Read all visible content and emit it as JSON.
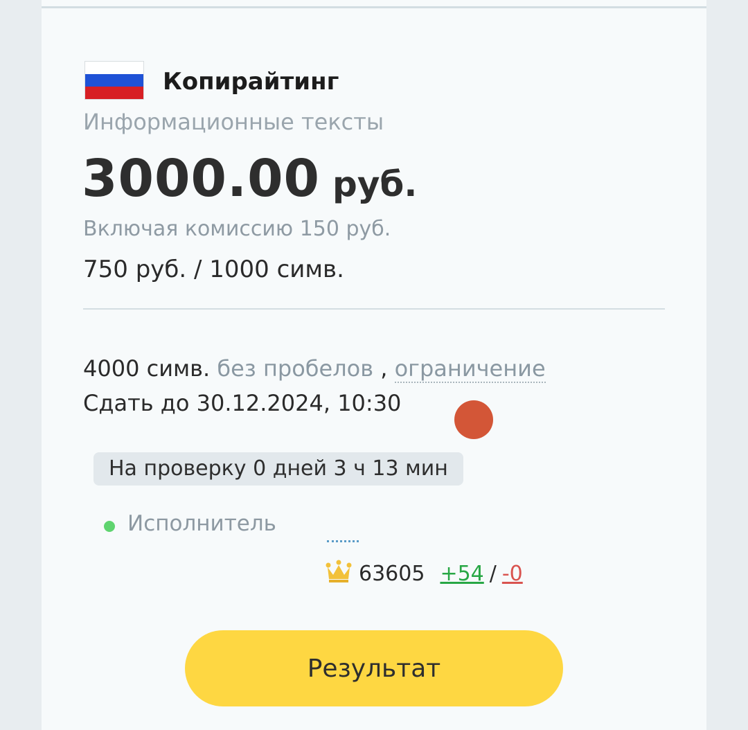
{
  "order": {
    "category": "Копирайтинг",
    "subcategory": "Информационные тексты",
    "price_amount": "3000.00",
    "price_currency": "руб.",
    "commission": "Включая комиссию 150 руб.",
    "rate": "750 руб. / 1000 симв.",
    "volume_count": "4000 симв.",
    "volume_type": "без пробелов",
    "volume_sep": ",",
    "volume_limit": "ограничение",
    "deadline": "Сдать до 30.12.2024, 10:30",
    "review_badge": "На проверку 0 дней 3 ч 13 мин"
  },
  "performer": {
    "label": "Исполнитель",
    "rating": "63605",
    "positive": "+54",
    "separator": "/",
    "negative": "-0"
  },
  "actions": {
    "result_label": "Результат"
  },
  "icons": {
    "flag": "russia-flag-icon",
    "crown": "crown-icon",
    "status": "online-status-icon"
  },
  "colors": {
    "button_bg": "#fed742",
    "positive": "#28a745",
    "negative": "#d9534f",
    "online": "#5fd46f"
  }
}
